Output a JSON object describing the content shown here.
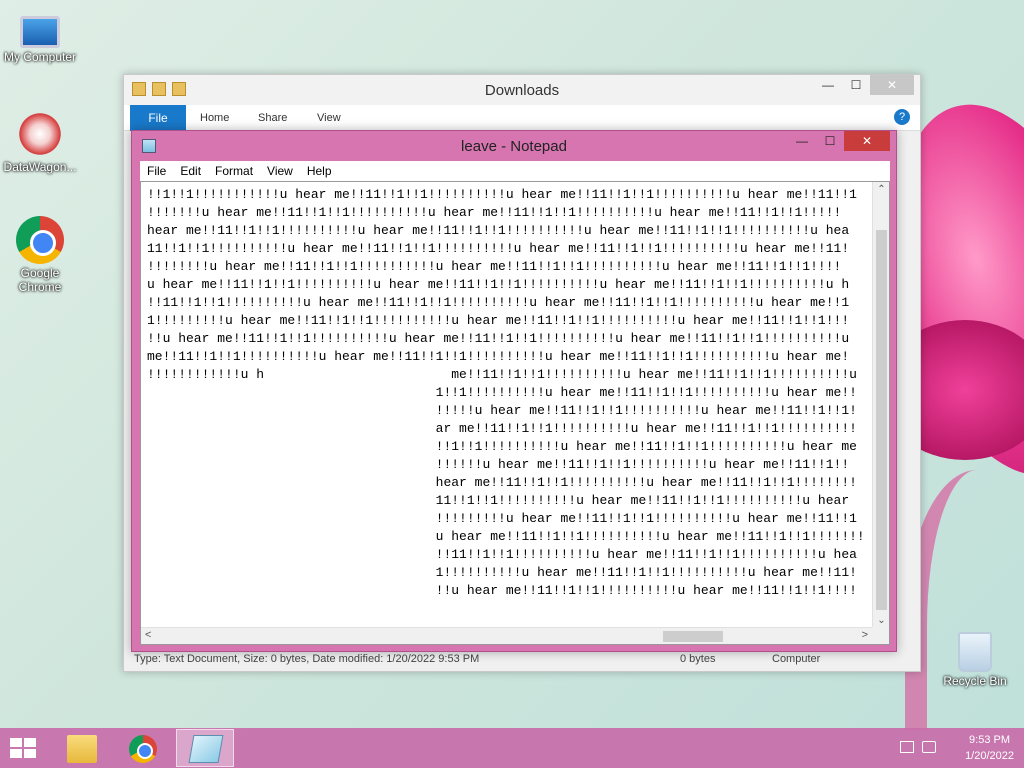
{
  "desktop": {
    "icons": [
      {
        "label": "My Computer"
      },
      {
        "label": "DataWagon..."
      },
      {
        "label": "Google Chrome"
      },
      {
        "label": "Recycle Bin"
      }
    ]
  },
  "explorer": {
    "title": "Downloads",
    "ribbon": {
      "file": "File",
      "tabs": [
        "Home",
        "Share",
        "View"
      ]
    },
    "status": {
      "details": "Type: Text Document, Size: 0 bytes, Date modified: 1/20/2022 9:53 PM",
      "size": "0 bytes",
      "location": "Computer"
    }
  },
  "notepad": {
    "title": "leave - Notepad",
    "menu": [
      "File",
      "Edit",
      "Format",
      "View",
      "Help"
    ],
    "lines": [
      "!!1!!1!!!!!!!!!!!u hear me!!11!!1!!1!!!!!!!!!!u hear me!!11!!1!!1!!!!!!!!!!u hear me!!11!!1",
      "!!!!!!!u hear me!!11!!1!!1!!!!!!!!!!u hear me!!11!!1!!1!!!!!!!!!!u hear me!!11!!1!!1!!!!!",
      "hear me!!11!!1!!1!!!!!!!!!!u hear me!!11!!1!!1!!!!!!!!!!u hear me!!11!!1!!1!!!!!!!!!!u hea",
      "11!!1!!1!!!!!!!!!!u hear me!!11!!1!!1!!!!!!!!!!u hear me!!11!!1!!1!!!!!!!!!!u hear me!!11!",
      "!!!!!!!!u hear me!!11!!1!!1!!!!!!!!!!u hear me!!11!!1!!1!!!!!!!!!!u hear me!!11!!1!!1!!!!",
      "u hear me!!11!!1!!1!!!!!!!!!!u hear me!!11!!1!!1!!!!!!!!!!u hear me!!11!!1!!1!!!!!!!!!!u h",
      "!!11!!1!!1!!!!!!!!!!u hear me!!11!!1!!1!!!!!!!!!!u hear me!!11!!1!!1!!!!!!!!!!u hear me!!1",
      "1!!!!!!!!!u hear me!!11!!1!!1!!!!!!!!!!u hear me!!11!!1!!1!!!!!!!!!!u hear me!!11!!1!!1!!!",
      "!!u hear me!!11!!1!!1!!!!!!!!!!u hear me!!11!!1!!1!!!!!!!!!!u hear me!!11!!1!!1!!!!!!!!!!u",
      "me!!11!!1!!1!!!!!!!!!!u hear me!!11!!1!!1!!!!!!!!!!u hear me!!11!!1!!1!!!!!!!!!!u hear me!",
      "!!!!!!!!!!!!u h                        me!!11!!1!!1!!!!!!!!!!u hear me!!11!!1!!1!!!!!!!!!!u",
      "                                     1!!1!!!!!!!!!!u hear me!!11!!1!!1!!!!!!!!!!u hear me!!",
      "                                     !!!!!u hear me!!11!!1!!1!!!!!!!!!!u hear me!!11!!1!!1!",
      "                                     ar me!!11!!1!!1!!!!!!!!!!u hear me!!11!!1!!1!!!!!!!!!!",
      "                                     !!1!!1!!!!!!!!!!u hear me!!11!!1!!1!!!!!!!!!!u hear me",
      "                                     !!!!!!u hear me!!11!!1!!1!!!!!!!!!!u hear me!!11!!1!!",
      "                                     hear me!!11!!1!!1!!!!!!!!!!u hear me!!11!!1!!1!!!!!!!!",
      "                                     11!!1!!1!!!!!!!!!!u hear me!!11!!1!!1!!!!!!!!!!u hear",
      "                                     !!!!!!!!!u hear me!!11!!1!!1!!!!!!!!!!u hear me!!11!!1",
      "                                     u hear me!!11!!1!!1!!!!!!!!!!u hear me!!11!!1!!1!!!!!!!",
      "                                     !!11!!1!!1!!!!!!!!!!u hear me!!11!!1!!1!!!!!!!!!!u hea",
      "                                     1!!!!!!!!!!u hear me!!11!!1!!1!!!!!!!!!!u hear me!!11!",
      "                                     !!u hear me!!11!!1!!1!!!!!!!!!!u hear me!!11!!1!!1!!!!"
    ]
  },
  "taskbar": {
    "time": "9:53 PM",
    "date": "1/20/2022"
  },
  "colors": {
    "notepad_frame": "#d775b0",
    "close_red": "#c83c3c",
    "file_tab_blue": "#1979ca",
    "taskbar": "#c86eaa"
  }
}
